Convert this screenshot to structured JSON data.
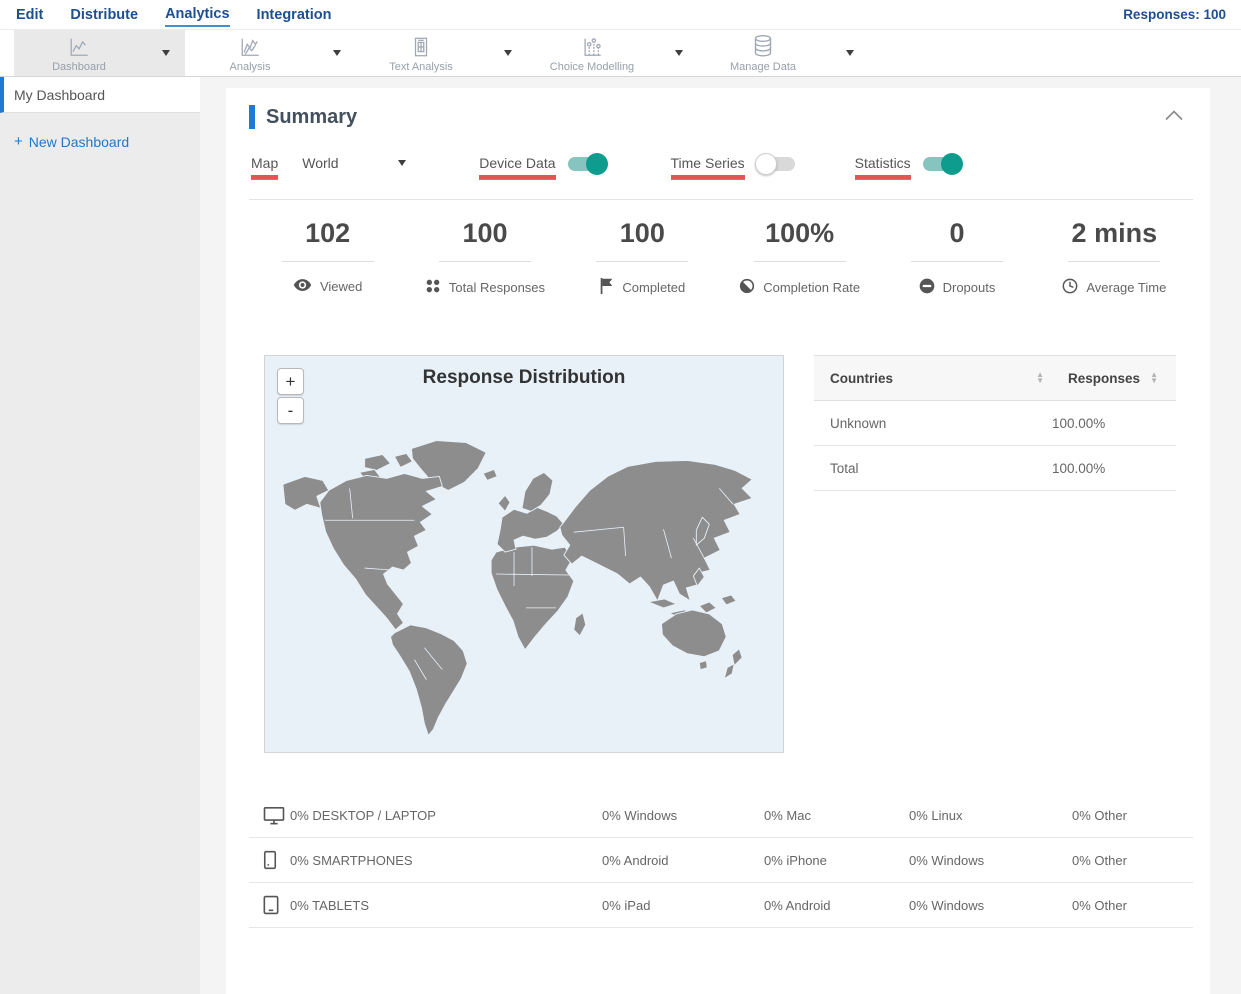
{
  "nav": {
    "items": [
      {
        "label": "Edit",
        "active": false
      },
      {
        "label": "Distribute",
        "active": false
      },
      {
        "label": "Analytics",
        "active": true
      },
      {
        "label": "Integration",
        "active": false
      }
    ],
    "responses_status": "Responses: 100"
  },
  "toolbar": {
    "items": [
      {
        "label": "Dashboard",
        "icon": "line-chart-icon",
        "selected": true
      },
      {
        "label": "Analysis",
        "icon": "area-chart-icon",
        "selected": false
      },
      {
        "label": "Text Analysis",
        "icon": "document-table-icon",
        "selected": false
      },
      {
        "label": "Choice Modelling",
        "icon": "scatter-chart-icon",
        "selected": false
      },
      {
        "label": "Manage Data",
        "icon": "database-icon",
        "selected": false
      }
    ]
  },
  "sidebar": {
    "items": [
      {
        "label": "My Dashboard",
        "active": true
      }
    ],
    "new_dashboard": {
      "plus": "+",
      "label": "New Dashboard"
    }
  },
  "summary": {
    "title": "Summary",
    "controls": {
      "map_label": "Map",
      "map_value": "World",
      "toggles": [
        {
          "label": "Device Data",
          "on": true
        },
        {
          "label": "Time Series",
          "on": false
        },
        {
          "label": "Statistics",
          "on": true
        }
      ]
    },
    "stats": [
      {
        "value": "102",
        "label": "Viewed",
        "icon": "eye-icon"
      },
      {
        "value": "100",
        "label": "Total Responses",
        "icon": "dots-grid-icon"
      },
      {
        "value": "100",
        "label": "Completed",
        "icon": "flag-icon"
      },
      {
        "value": "100%",
        "label": "Completion Rate",
        "icon": "half-circle-icon"
      },
      {
        "value": "0",
        "label": "Dropouts",
        "icon": "minus-circle-icon"
      },
      {
        "value": "2 mins",
        "label": "Average Time",
        "icon": "clock-icon"
      }
    ],
    "map": {
      "title": "Response Distribution",
      "zoom_in": "+",
      "zoom_out": "-"
    },
    "countries_table": {
      "col1_header": "Countries",
      "col2_header": "Responses",
      "rows": [
        {
          "country": "Unknown",
          "responses": "100.00%"
        },
        {
          "country": "Total",
          "responses": "100.00%"
        }
      ]
    },
    "device_table": {
      "rows": [
        {
          "icon": "desktop-icon",
          "category": "0% DESKTOP / LAPTOP",
          "c1": "0% Windows",
          "c2": "0% Mac",
          "c3": "0% Linux",
          "c4": "0% Other"
        },
        {
          "icon": "smartphone-icon",
          "category": "0% SMARTPHONES",
          "c1": "0% Android",
          "c2": "0% iPhone",
          "c3": "0% Windows",
          "c4": "0% Other"
        },
        {
          "icon": "tablet-icon",
          "category": "0% TABLETS",
          "c1": "0% iPad",
          "c2": "0% Android",
          "c3": "0% Windows",
          "c4": "0% Other"
        }
      ]
    }
  },
  "colors": {
    "nav_blue": "#1d4f91",
    "accent_blue": "#1f7ad4",
    "link_blue": "#2079c8",
    "underline_red": "#e2564b",
    "toggle_on_knob": "#0d9c8e",
    "toggle_on_track": "#85c4bf",
    "map_bg": "#e9f1f8",
    "land_gray": "#8d8d8d"
  }
}
